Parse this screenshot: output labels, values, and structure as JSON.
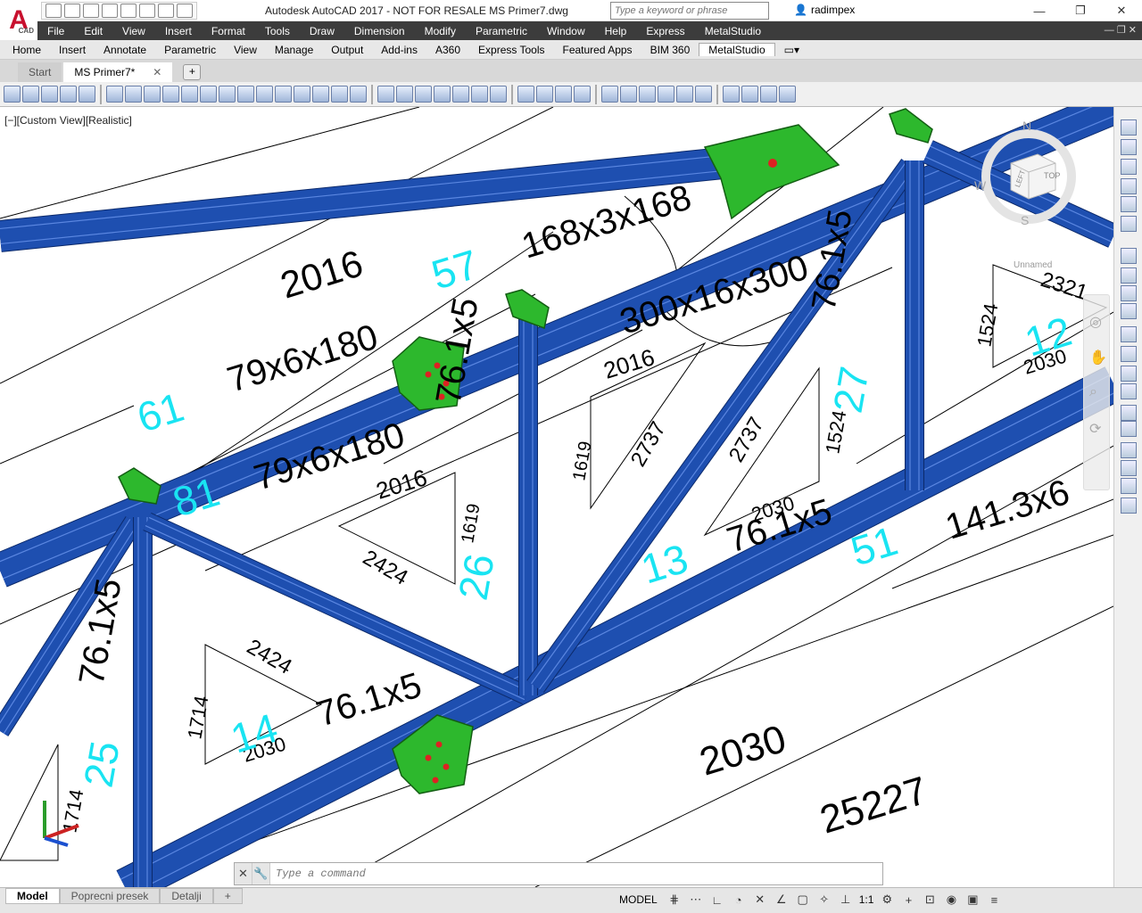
{
  "window": {
    "title": "Autodesk AutoCAD 2017 - NOT FOR RESALE    MS Primer7.dwg",
    "search_placeholder": "Type a keyword or phrase",
    "user": "radimpex",
    "controls": [
      "—",
      "❐",
      "✕"
    ]
  },
  "app": {
    "logo": "A",
    "logo_sub": "CAD"
  },
  "menu": {
    "items": [
      "File",
      "Edit",
      "View",
      "Insert",
      "Format",
      "Tools",
      "Draw",
      "Dimension",
      "Modify",
      "Parametric",
      "Window",
      "Help",
      "Express",
      "MetalStudio"
    ],
    "controls": "— ❐ ✕"
  },
  "ribbon": {
    "tabs": [
      "Home",
      "Insert",
      "Annotate",
      "Parametric",
      "View",
      "Manage",
      "Output",
      "Add-ins",
      "A360",
      "Express Tools",
      "Featured Apps",
      "BIM 360",
      "MetalStudio"
    ],
    "active": "MetalStudio"
  },
  "doc_tabs": {
    "items": [
      "Start",
      "MS Primer7*"
    ],
    "active": "MS Primer7*",
    "close": "✕",
    "add": "+"
  },
  "viewport": {
    "label": "[−][Custom View][Realistic]"
  },
  "viewcube": {
    "n": "N",
    "w": "W",
    "s": "S",
    "top": "TOP",
    "left": "LEFT"
  },
  "drawing": {
    "labels_black": [
      {
        "t": "2016",
        "s": 42
      },
      {
        "t": "168x3x168",
        "s": 40
      },
      {
        "t": "300x16x300",
        "s": 40
      },
      {
        "t": "79x6x180",
        "s": 40
      },
      {
        "t": "79x6x180",
        "s": 40
      },
      {
        "t": "2016",
        "s": 26
      },
      {
        "t": "1619",
        "s": 20
      },
      {
        "t": "2737",
        "s": 24
      },
      {
        "t": "2737",
        "s": 24
      },
      {
        "t": "1524",
        "s": 22
      },
      {
        "t": "2016",
        "s": 26
      },
      {
        "t": "1619",
        "s": 20
      },
      {
        "t": "2424",
        "s": 24
      },
      {
        "t": "76.1x5",
        "s": 40
      },
      {
        "t": "76.1x5",
        "s": 38
      },
      {
        "t": "2030",
        "s": 22
      },
      {
        "t": "76.1x5",
        "s": 40
      },
      {
        "t": "141.3x6",
        "s": 40
      },
      {
        "t": "76.1x5",
        "s": 40
      },
      {
        "t": "2424",
        "s": 24
      },
      {
        "t": "1714",
        "s": 22
      },
      {
        "t": "2030",
        "s": 22
      },
      {
        "t": "76.1x5",
        "s": 40
      },
      {
        "t": "2030",
        "s": 44
      },
      {
        "t": "25227",
        "s": 44
      },
      {
        "t": "1524",
        "s": 22
      },
      {
        "t": "2321",
        "s": 24
      },
      {
        "t": "2030",
        "s": 22
      },
      {
        "t": "1714",
        "s": 22
      },
      {
        "t": "2016",
        "s": 28
      },
      {
        "t": "76.1",
        "s": 40
      }
    ],
    "labels_cyan": [
      {
        "t": "57"
      },
      {
        "t": "61"
      },
      {
        "t": "81"
      },
      {
        "t": "26"
      },
      {
        "t": "27"
      },
      {
        "t": "13"
      },
      {
        "t": "51"
      },
      {
        "t": "12"
      },
      {
        "t": "14"
      },
      {
        "t": "25"
      }
    ],
    "block_name": "Unnamed"
  },
  "command": {
    "placeholder": "Type a command",
    "close": "✕",
    "tool": "🔧"
  },
  "layout_tabs": {
    "items": [
      "Model",
      "Poprecni presek",
      "Detalji"
    ],
    "active": "Model",
    "add": "+"
  },
  "status": {
    "model": "MODEL",
    "scale": "1:1",
    "icons": [
      "grid-icon",
      "snap-icon",
      "ortho-icon",
      "polar-icon",
      "osnap-icon",
      "otrack-icon",
      "lweight-icon",
      "annotation-icon",
      "scale-icon",
      "gear-icon",
      "plus-icon",
      "isolate-icon",
      "hardware-icon",
      "fullscreen-icon",
      "menu-icon"
    ]
  },
  "colors": {
    "member": "#1e4fb0",
    "member_edge": "#0c2a6b",
    "plate": "#2db82d",
    "cyan": "#19e4f2",
    "menu_bg": "#3c3c3c"
  }
}
